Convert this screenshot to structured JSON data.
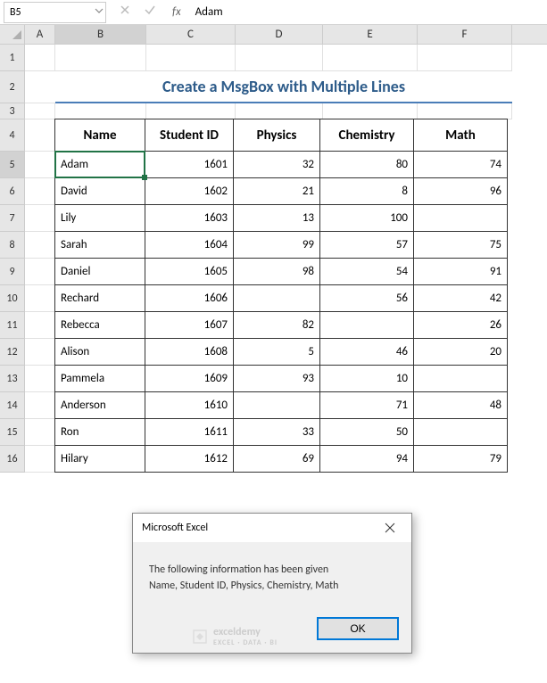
{
  "name_box": "B5",
  "formula_value": "Adam",
  "columns": [
    "A",
    "B",
    "C",
    "D",
    "E",
    "F"
  ],
  "title": "Create a MsgBox with Multiple Lines",
  "headers": [
    "Name",
    "Student ID",
    "Physics",
    "Chemistry",
    "Math"
  ],
  "rows": [
    {
      "n": 5,
      "name": "Adam",
      "id": "1601",
      "phy": "32",
      "chem": "80",
      "math": "74"
    },
    {
      "n": 6,
      "name": "David",
      "id": "1602",
      "phy": "21",
      "chem": "8",
      "math": "96"
    },
    {
      "n": 7,
      "name": "Lily",
      "id": "1603",
      "phy": "13",
      "chem": "100",
      "math": ""
    },
    {
      "n": 8,
      "name": "Sarah",
      "id": "1604",
      "phy": "99",
      "chem": "57",
      "math": "75"
    },
    {
      "n": 9,
      "name": "Daniel",
      "id": "1605",
      "phy": "98",
      "chem": "54",
      "math": "91"
    },
    {
      "n": 10,
      "name": "Rechard",
      "id": "1606",
      "phy": "",
      "chem": "56",
      "math": "42"
    },
    {
      "n": 11,
      "name": "Rebecca",
      "id": "1607",
      "phy": "82",
      "chem": "",
      "math": "26"
    },
    {
      "n": 12,
      "name": "Alison",
      "id": "1608",
      "phy": "5",
      "chem": "46",
      "math": "20"
    },
    {
      "n": 13,
      "name": "Pammela",
      "id": "1609",
      "phy": "93",
      "chem": "10",
      "math": ""
    },
    {
      "n": 14,
      "name": "Anderson",
      "id": "1610",
      "phy": "",
      "chem": "71",
      "math": "48"
    },
    {
      "n": 15,
      "name": "Ron",
      "id": "1611",
      "phy": "33",
      "chem": "50",
      "math": ""
    },
    {
      "n": 16,
      "name": "Hilary",
      "id": "1612",
      "phy": "69",
      "chem": "94",
      "math": "79"
    }
  ],
  "msgbox": {
    "title": "Microsoft Excel",
    "line1": "The following information has been given",
    "line2": "Name, Student ID, Physics, Chemistry, Math",
    "ok": "OK"
  },
  "watermark": {
    "main": "exceldemy",
    "sub": "EXCEL · DATA · BI"
  },
  "fx": "fx"
}
